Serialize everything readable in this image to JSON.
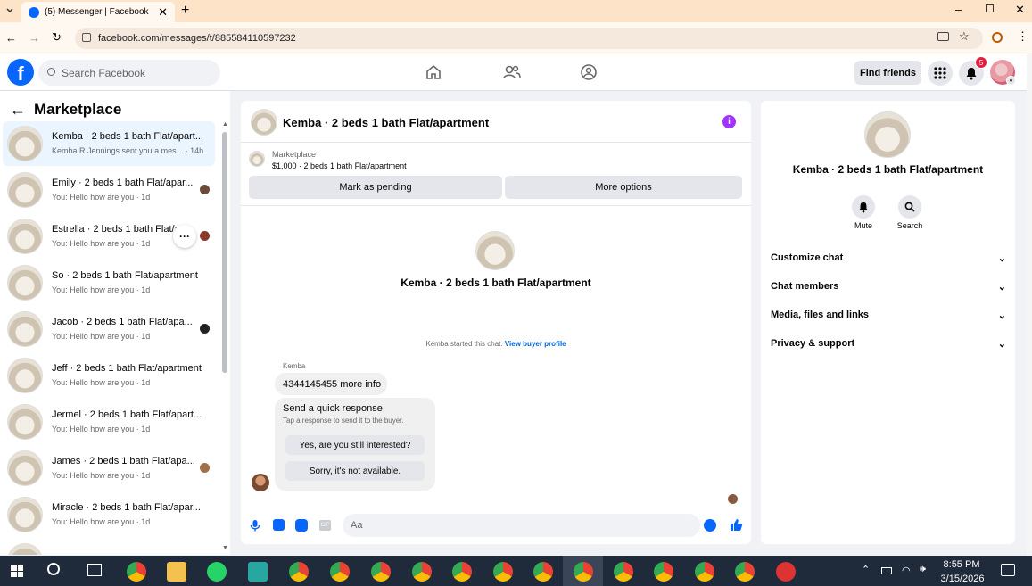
{
  "browser": {
    "tab_title": "(5) Messenger | Facebook",
    "url": "facebook.com/messages/t/885584110597232"
  },
  "header": {
    "search_placeholder": "Search Facebook",
    "find_friends": "Find friends",
    "notification_count": "5"
  },
  "sidebar": {
    "title": "Marketplace",
    "conversations": [
      {
        "title": "Kemba · 2 beds 1 bath Flat/apart...",
        "preview": "Kemba R Jennings sent you a mes... · 14h",
        "active": true
      },
      {
        "title": "Emily · 2 beds 1 bath Flat/apar...",
        "preview": "You: Hello how are you · 1d"
      },
      {
        "title": "Estrella · 2 beds 1 bath Flat/a",
        "preview": "You: Hello how are you · 1d"
      },
      {
        "title": "So · 2 beds 1 bath Flat/apartment",
        "preview": "You: Hello how are you · 1d"
      },
      {
        "title": "Jacob · 2 beds 1 bath Flat/apa...",
        "preview": "You: Hello how are you · 1d"
      },
      {
        "title": "Jeff · 2 beds 1 bath Flat/apartment",
        "preview": "You: Hello how are you · 1d"
      },
      {
        "title": "Jermel · 2 beds 1 bath Flat/apart...",
        "preview": "You: Hello how are you · 1d"
      },
      {
        "title": "James · 2 beds 1 bath Flat/apa...",
        "preview": "You: Hello how are you · 1d"
      },
      {
        "title": "Miracle · 2 beds 1 bath Flat/apar...",
        "preview": "You: Hello how are you · 1d"
      }
    ]
  },
  "chat": {
    "title": "Kemba · 2 beds 1 bath Flat/apartment",
    "listing_source": "Marketplace",
    "listing_line": "$1,000 · 2 beds 1 bath Flat/apartment",
    "mark_pending": "Mark as pending",
    "more_options": "More options",
    "center_title": "Kemba · 2 beds 1 bath Flat/apartment",
    "started_text": "Kemba started this chat.",
    "view_profile": "View buyer profile",
    "sender": "Kemba",
    "message": "4344145455 more info",
    "quick_title": "Send a quick response",
    "quick_sub": "Tap a response to send it to the buyer.",
    "quick_1": "Yes, are you still interested?",
    "quick_2": "Sorry, it's not available.",
    "composer_placeholder": "Aa"
  },
  "details": {
    "title": "Kemba · 2 beds 1 bath Flat/apartment",
    "mute": "Mute",
    "search": "Search",
    "sections": [
      "Customize chat",
      "Chat members",
      "Media, files and links",
      "Privacy & support"
    ]
  },
  "taskbar": {
    "time": "8:55 PM",
    "date": "3/15/2026"
  },
  "colors": {
    "fb_blue": "#0866ff",
    "link": "#0064d1",
    "notif_red": "#e41e3f",
    "info_purple": "#a033ff"
  }
}
